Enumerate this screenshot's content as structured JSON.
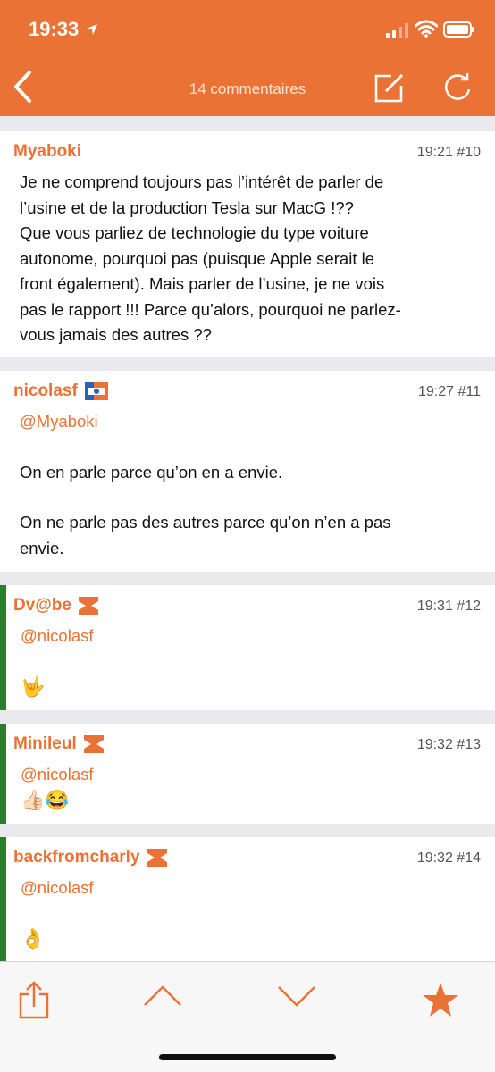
{
  "status_bar": {
    "time": "19:33"
  },
  "nav": {
    "title": "14 commentaires"
  },
  "comments": [
    {
      "author": "Myaboki",
      "meta": "19:21 #10",
      "lines": [
        "Je ne comprend toujours pas l’intérêt de parler de",
        "l’usine et de la production Tesla sur MacG !??",
        "Que vous parliez de technologie du type voiture",
        "autonome, pourquoi pas (puisque Apple serait le",
        "front également). Mais parler de l’usine, je ne vois",
        "pas le rapport !!! Parce qu’alors, pourquoi ne parlez-",
        "vous jamais des autres ??"
      ]
    },
    {
      "author": "nicolasf",
      "meta": "19:27 #11",
      "mention": "@Myaboki",
      "p1": "On en parle parce qu’on en a envie.",
      "p2_l1": "On ne parle pas des autres parce qu’on n’en a pas",
      "p2_l2": "envie."
    },
    {
      "author": "Dv@be",
      "meta": "19:31 #12",
      "mention": "@nicolasf",
      "emoji": "🤟"
    },
    {
      "author": "Minileul",
      "meta": "19:32 #13",
      "mention": "@nicolasf",
      "emoji": "👍🏻😂"
    },
    {
      "author": "backfromcharly",
      "meta": "19:32 #14",
      "mention": "@nicolasf",
      "emoji": "👌"
    }
  ],
  "colors": {
    "accent": "#ea7234",
    "reply_bar": "#2f7d2c"
  },
  "icons": [
    "location-arrow-icon",
    "signal-icon",
    "wifi-icon",
    "battery-icon",
    "back-chevron-icon",
    "compose-icon",
    "refresh-icon",
    "share-icon",
    "chevron-up-icon",
    "chevron-down-icon",
    "star-icon"
  ]
}
